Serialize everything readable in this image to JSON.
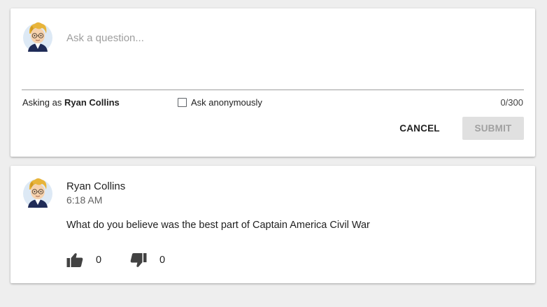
{
  "composer": {
    "placeholder": "Ask a question...",
    "asking_as_prefix": "Asking as",
    "asking_as_name": "Ryan Collins",
    "anonymous_label": "Ask anonymously",
    "anonymous_checked": false,
    "char_count": "0/300",
    "cancel_label": "CANCEL",
    "submit_label": "SUBMIT",
    "avatar_icon": "user-avatar-icon"
  },
  "post": {
    "author": "Ryan Collins",
    "time": "6:18 AM",
    "text": "What do you believe was the best part of Captain America Civil War",
    "likes": "0",
    "dislikes": "0",
    "like_icon": "thumbs-up-icon",
    "dislike_icon": "thumbs-down-icon",
    "avatar_icon": "user-avatar-icon"
  },
  "colors": {
    "background": "#eeeeee",
    "card": "#ffffff",
    "submit_disabled_bg": "#e0e0e0",
    "submit_disabled_text": "#a0a0a0",
    "icon": "#424242"
  }
}
